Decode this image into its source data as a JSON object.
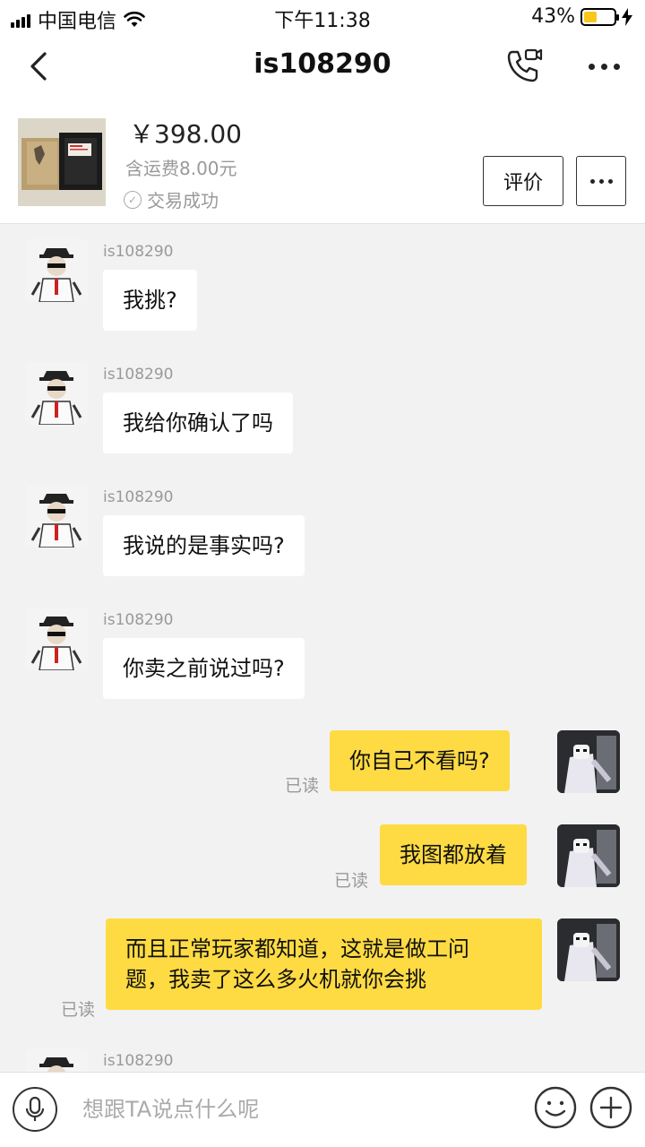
{
  "status_bar": {
    "carrier": "中国电信",
    "time": "下午11:38",
    "battery": "43%",
    "battery_level": 0.43
  },
  "nav": {
    "title": "is108290",
    "call_icon": "phone-video-icon",
    "more_icon": "more-dots-icon",
    "back_icon": "chevron-left-icon"
  },
  "product": {
    "price": "￥398.00",
    "shipping": "含运费8.00元",
    "status": "交易成功",
    "review_label": "评价"
  },
  "messages": [
    {
      "sender": "is108290",
      "text": "我挑?"
    },
    {
      "sender": "is108290",
      "text": "我给你确认了吗"
    },
    {
      "sender": "is108290",
      "text": "我说的是事实吗?"
    },
    {
      "sender": "is108290",
      "text": "你卖之前说过吗?"
    },
    {
      "text": "你自己不看吗?",
      "read": "已读"
    },
    {
      "text": "我图都放着",
      "read": "已读"
    },
    {
      "text": "而且正常玩家都知道，这就是做工问\n题，我卖了这么多火机就你会挑",
      "read": "已读"
    },
    {
      "sender": "is108290"
    }
  ],
  "input": {
    "placeholder": "想跟TA说点什么呢"
  },
  "colors": {
    "outgoing_bubble": "#fedb43",
    "incoming_bubble": "#ffffff",
    "background": "#f2f2f2"
  }
}
